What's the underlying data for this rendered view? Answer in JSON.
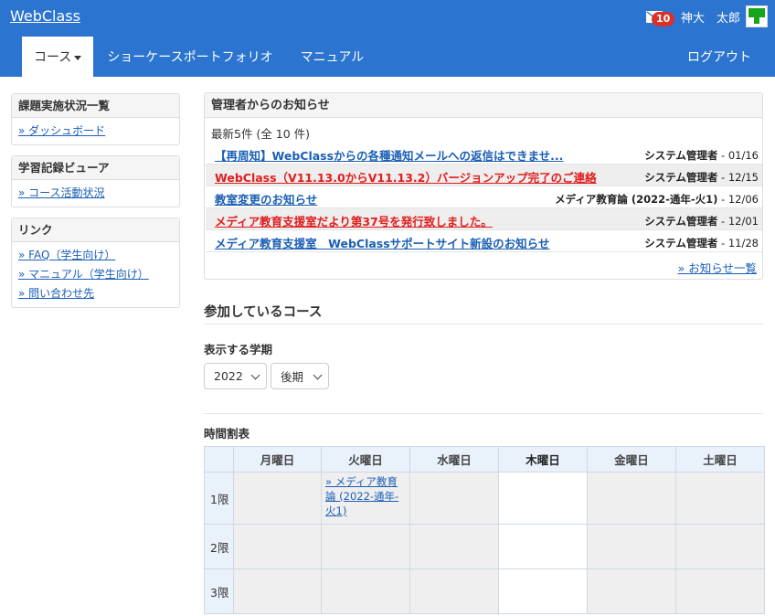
{
  "header": {
    "brand": "WebClass",
    "mail_count": "10",
    "user_name": "神大　太郎",
    "nav": [
      {
        "label": "コース"
      },
      {
        "label": "ショーケースポートフォリオ"
      },
      {
        "label": "マニュアル"
      }
    ],
    "logout": "ログアウト"
  },
  "sidebar": {
    "panels": [
      {
        "title": "課題実施状況一覧",
        "links": [
          "» ダッシュボード"
        ]
      },
      {
        "title": "学習記録ビューア",
        "links": [
          "» コース活動状況"
        ]
      },
      {
        "title": "リンク",
        "links": [
          "» FAQ（学生向け）",
          "» マニュアル（学生向け）",
          "» 問い合わせ先"
        ]
      }
    ]
  },
  "notices": {
    "title": "管理者からのお知らせ",
    "count": "最新5件 (全 10 件)",
    "items": [
      {
        "title": "【再周知】WebClassからの各種通知メールへの返信はできませ...",
        "sender": "システム管理者",
        "date": " - 01/16",
        "color": "#1b5fb5"
      },
      {
        "title": "WebClass（V11.13.0からV11.13.2）バージョンアップ完了のご連絡",
        "sender": "システム管理者",
        "date": " - 12/15",
        "color": "#e11d1d"
      },
      {
        "title": "教室変更のお知らせ",
        "sender": "メディア教育論 (2022-通年-火1)",
        "date": " - 12/06",
        "color": "#1b5fb5"
      },
      {
        "title": "メディア教育支援室だより第37号を発行致しました。",
        "sender": "システム管理者",
        "date": " - 12/01",
        "color": "#e11d1d"
      },
      {
        "title": "メディア教育支援室　WebClassサポートサイト新設のお知らせ",
        "sender": "システム管理者",
        "date": " - 11/28",
        "color": "#1b5fb5"
      }
    ],
    "more": "» お知らせ一覧"
  },
  "courses": {
    "title": "参加しているコース",
    "term_label": "表示する学期",
    "year": "2022",
    "term": "後期",
    "timetable_label": "時間割表",
    "days": [
      "月曜日",
      "火曜日",
      "水曜日",
      "木曜日",
      "金曜日",
      "土曜日"
    ],
    "today_index": 3,
    "periods": [
      "1限",
      "2限",
      "3限"
    ],
    "course_link": "» メディア教育論 (2022-通年-火1)"
  },
  "colors": {
    "header_bg": "#2b74d0",
    "link": "#1b5fb5",
    "alert_red": "#e11d1d",
    "badge_red": "#d9322b"
  }
}
